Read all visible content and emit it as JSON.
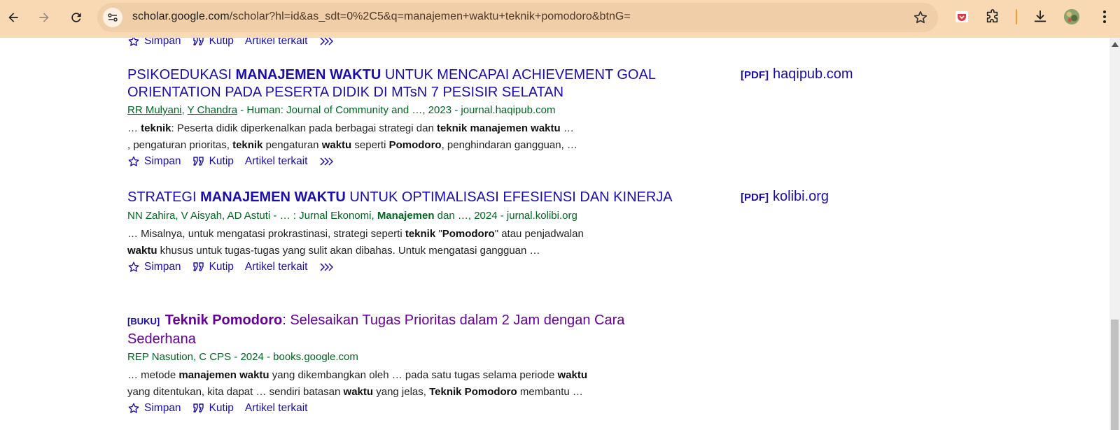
{
  "browser": {
    "url_host": "scholar.google.com",
    "url_path": "/scholar?hl=id&as_sdt=0%2C5&q=manajemen+waktu+teknik+pomodoro&btnG=",
    "icons": [
      "back-icon",
      "forward-icon",
      "reload-icon",
      "site-info-icon",
      "bookmark-star-icon",
      "extension-pocket-icon",
      "extensions-puzzle-icon",
      "download-icon",
      "profile-avatar",
      "menu-kebab-icon"
    ]
  },
  "top_actions": {
    "save": "Simpan",
    "cite": "Kutip",
    "related": "Artikel terkait"
  },
  "results": [
    {
      "title_pre": "PSIKOEDUKASI ",
      "title_bold": "MANAJEMEN WAKTU",
      "title_post": " UNTUK MENCAPAI ACHIEVEMENT GOAL ORIENTATION PADA PESERTA DIDIK DI MTsN 7 PESISIR SELATAN",
      "author1": "RR Mulyani",
      "author_sep": ", ",
      "author2": "Y Chandra",
      "source": " - Human: Journal of Community and …, 2023 - journal.haqipub.com",
      "snippet": [
        [
          "… ",
          "teknik",
          ": Peserta didik diperkenalkan pada berbagai strategi dan ",
          "teknik manajemen waktu",
          " …"
        ],
        [
          ", pengaturan prioritas, ",
          "teknik",
          " pengaturan ",
          "waktu",
          " seperti ",
          "Pomodoro",
          ", penghindaran gangguan, …"
        ]
      ],
      "actions": {
        "save": "Simpan",
        "cite": "Kutip",
        "related": "Artikel terkait"
      },
      "side_tag": "[PDF]",
      "side_domain": "haqipub.com"
    },
    {
      "title_pre": "STRATEGI ",
      "title_bold": "MANAJEMEN WAKTU",
      "title_post": " UNTUK OPTIMALISASI EFESIENSI DAN KINERJA",
      "authors_text_a": "NN Zahira, V Aisyah, AD Astuti - … : Jurnal Ekonomi, ",
      "authors_bold": "Manajemen",
      "authors_text_b": " dan …, 2024 - jurnal.kolibi.org",
      "snippet": [
        [
          "… Misalnya, untuk mengatasi prokrastinasi, strategi seperti ",
          "teknik",
          " \"",
          "Pomodoro",
          "\" atau penjadwalan"
        ],
        [
          "",
          "waktu",
          " khusus untuk tugas-tugas yang sulit akan dibahas. Untuk mengatasi gangguan …"
        ]
      ],
      "actions": {
        "save": "Simpan",
        "cite": "Kutip",
        "related": "Artikel terkait"
      },
      "side_tag": "[PDF]",
      "side_domain": "kolibi.org"
    },
    {
      "tag": "[BUKU]",
      "title_bold": "Teknik Pomodoro",
      "title_post": ": Selesaikan Tugas Prioritas dalam 2 Jam dengan Cara Sederhana",
      "authors_text": "REP Nasution, C CPS - 2024 - books.google.com",
      "snippet": [
        [
          "… metode ",
          "manajemen waktu",
          " yang dikembangkan oleh … pada satu tugas selama periode ",
          "waktu"
        ],
        [
          "yang ditentukan, kita dapat … sendiri batasan ",
          "waktu",
          " yang jelas, ",
          "Teknik Pomodoro",
          " membantu …"
        ]
      ],
      "actions": {
        "save": "Simpan",
        "cite": "Kutip",
        "related": "Artikel terkait"
      }
    }
  ]
}
